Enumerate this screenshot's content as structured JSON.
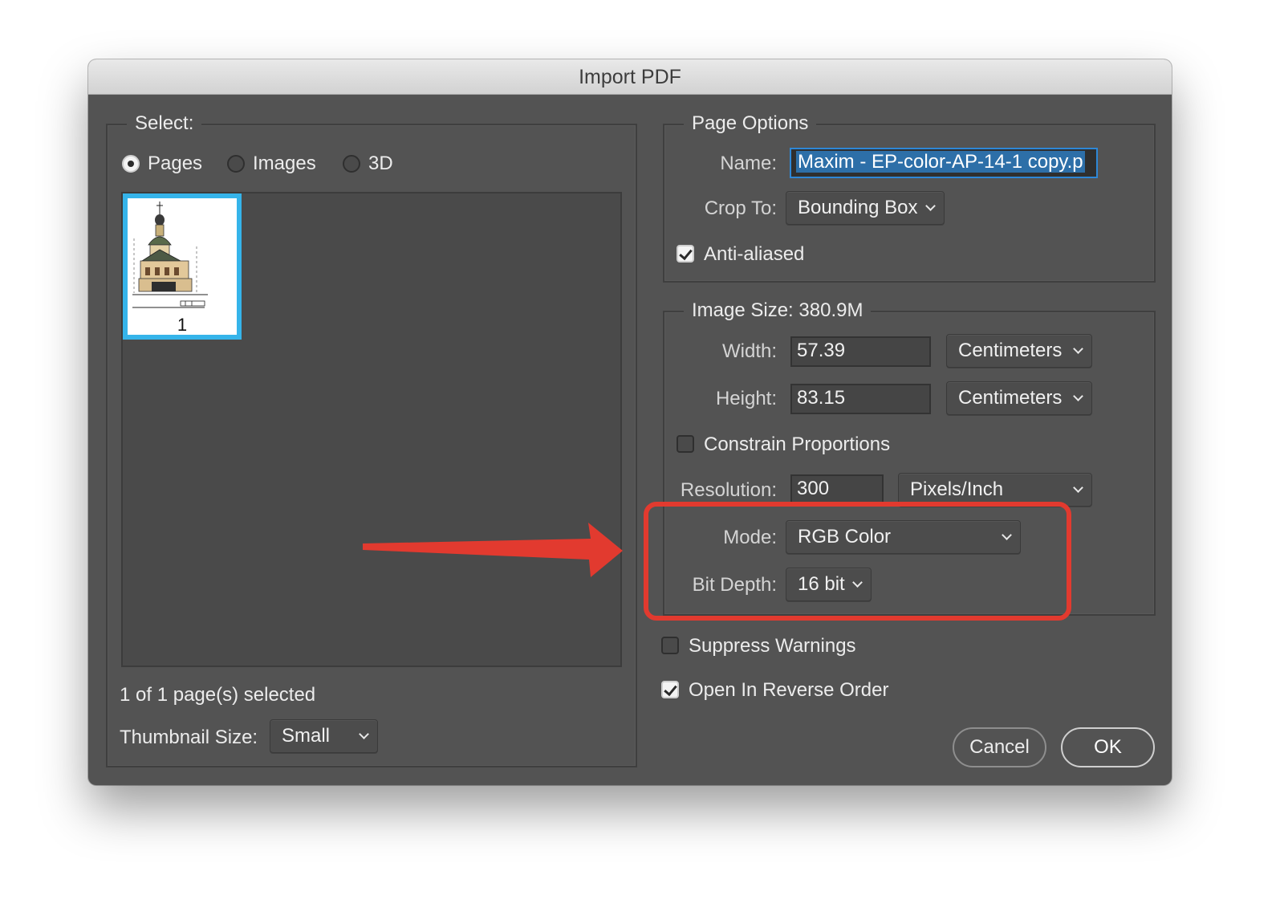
{
  "window": {
    "title": "Import PDF"
  },
  "select": {
    "legend": "Select:",
    "options": [
      {
        "label": "Pages",
        "selected": true
      },
      {
        "label": "Images",
        "selected": false
      },
      {
        "label": "3D",
        "selected": false
      }
    ],
    "thumbnails": [
      {
        "page_number": "1",
        "selected": true
      }
    ],
    "selection_status": "1 of 1 page(s) selected",
    "thumbnail_size": {
      "label": "Thumbnail Size:",
      "value": "Small"
    }
  },
  "page_options": {
    "legend": "Page Options",
    "name": {
      "label": "Name:",
      "value": "Maxim - EP-color-AP-14-1 copy.p"
    },
    "crop_to": {
      "label": "Crop To:",
      "value": "Bounding Box"
    },
    "anti_aliased": {
      "label": "Anti-aliased",
      "checked": true
    }
  },
  "image_size": {
    "legend": "Image Size: 380.9M",
    "width": {
      "label": "Width:",
      "value": "57.39",
      "unit": "Centimeters"
    },
    "height": {
      "label": "Height:",
      "value": "83.15",
      "unit": "Centimeters"
    },
    "constrain": {
      "label": "Constrain Proportions",
      "checked": false
    },
    "resolution": {
      "label": "Resolution:",
      "value": "300",
      "unit": "Pixels/Inch"
    },
    "mode": {
      "label": "Mode:",
      "value": "RGB Color"
    },
    "bit_depth": {
      "label": "Bit Depth:",
      "value": "16 bit"
    }
  },
  "suppress_warnings": {
    "label": "Suppress Warnings",
    "checked": false
  },
  "reverse_order": {
    "label": "Open In Reverse Order",
    "checked": true
  },
  "buttons": {
    "cancel": "Cancel",
    "ok": "OK"
  },
  "annotation": {
    "color": "#e23a2f"
  }
}
